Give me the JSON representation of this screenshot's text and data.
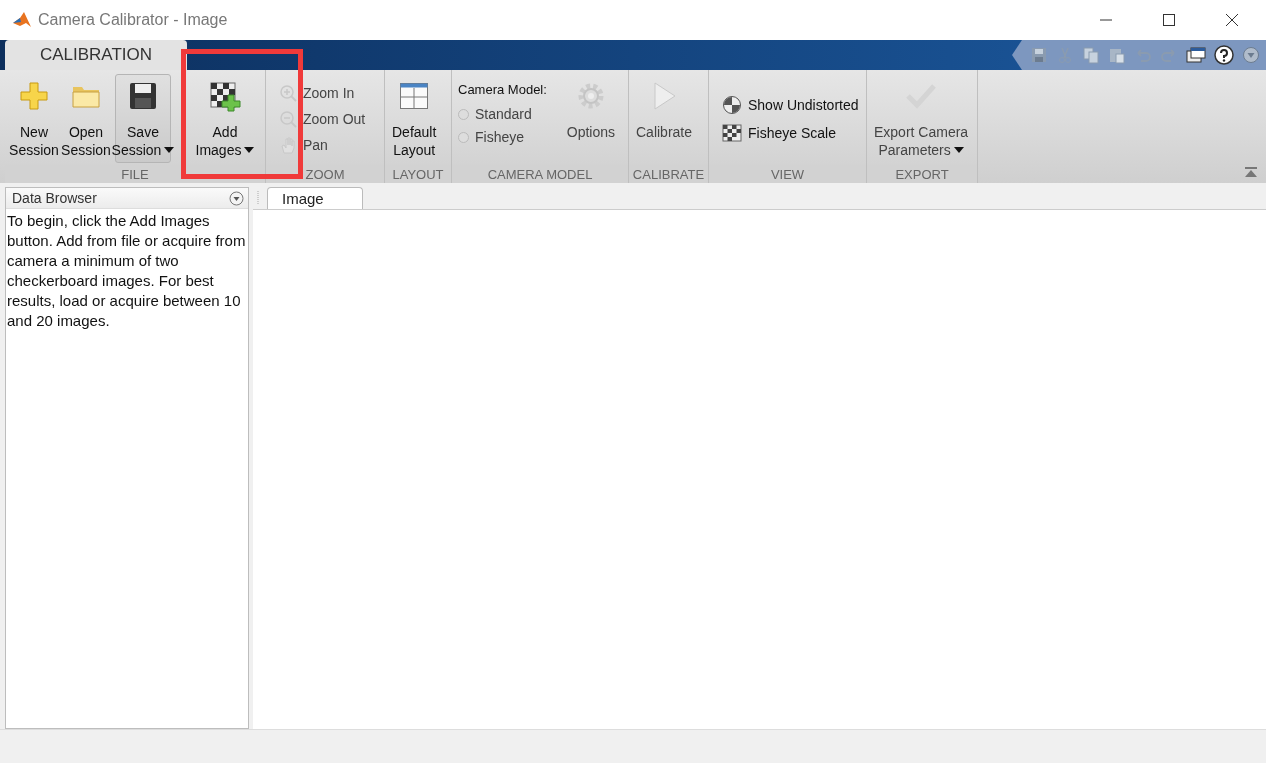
{
  "window": {
    "title": "Camera Calibrator - Image"
  },
  "ribbon_tabs": [
    {
      "label": "CALIBRATION",
      "selected": true
    }
  ],
  "file": {
    "label": "FILE",
    "new_session": {
      "lines": [
        "New",
        "Session"
      ]
    },
    "open_session": {
      "lines": [
        "Open",
        "Session"
      ]
    },
    "save_session": {
      "lines": [
        "Save",
        "Session"
      ]
    },
    "add_images": {
      "lines": [
        "Add",
        "Images"
      ],
      "highlighted": true
    }
  },
  "zoom": {
    "label": "ZOOM",
    "items": [
      {
        "label": "Zoom In",
        "disabled": true
      },
      {
        "label": "Zoom Out",
        "disabled": true
      },
      {
        "label": "Pan",
        "disabled": true
      }
    ]
  },
  "layout": {
    "label": "LAYOUT",
    "default_layout": {
      "lines": [
        "Default",
        "Layout"
      ]
    }
  },
  "camera_model": {
    "label": "CAMERA MODEL",
    "caption": "Camera Model:",
    "options": [
      {
        "label": "Standard",
        "selected": false
      },
      {
        "label": "Fisheye",
        "selected": false
      }
    ],
    "options_button": {
      "label": "Options",
      "disabled": true
    }
  },
  "calibrate": {
    "label": "CALIBRATE",
    "button": {
      "label": "Calibrate",
      "disabled": true
    }
  },
  "view": {
    "label": "VIEW",
    "items": [
      {
        "label": "Show Undistorted"
      },
      {
        "label": "Fisheye Scale"
      }
    ]
  },
  "export": {
    "label": "EXPORT",
    "button": {
      "lines": [
        "Export Camera",
        "Parameters"
      ],
      "disabled": true
    }
  },
  "data_browser": {
    "title": "Data Browser",
    "message": "To begin, click the Add Images button. Add from file or acquire from camera a minimum of two checkerboard images. For best results, load or acquire between 10 and 20 images."
  },
  "document_tabs": [
    {
      "label": "Image",
      "selected": true
    }
  ]
}
